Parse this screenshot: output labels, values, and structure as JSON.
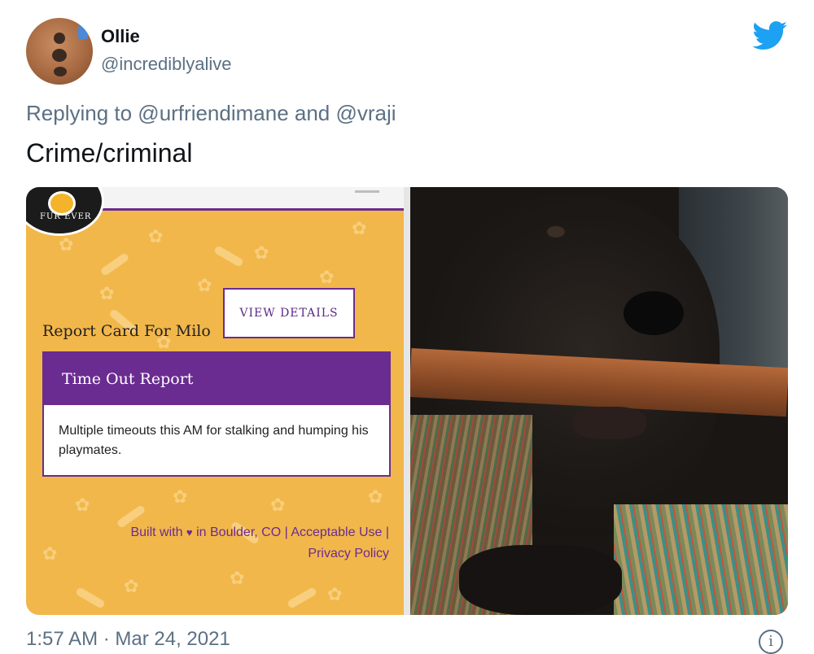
{
  "author": {
    "name": "Ollie",
    "handle": "@incrediblyalive"
  },
  "reply_line": "Replying to @urfriendimane and @vraji",
  "tweet_text": "Crime/criminal",
  "report_card": {
    "logo_text": "FUR EVER",
    "view_details_label": "VIEW DETAILS",
    "title": "Report Card For Milo",
    "section_title": "Time Out Report",
    "section_body": "Multiple timeouts this AM for stalking and humping his playmates.",
    "footer_built": "Built with",
    "footer_location": "in Boulder, CO",
    "footer_acceptable": "Acceptable Use",
    "footer_privacy": "Privacy Policy"
  },
  "timestamp": "1:57 AM · Mar 24, 2021",
  "info_glyph": "i",
  "colors": {
    "twitter_blue": "#1da1f2",
    "brand_purple": "#6a2c91",
    "card_yellow": "#f2b74a",
    "muted_text": "#5b7083"
  },
  "icons": [
    "twitter-bird-icon",
    "info-icon",
    "heart-icon",
    "paw-icon"
  ]
}
